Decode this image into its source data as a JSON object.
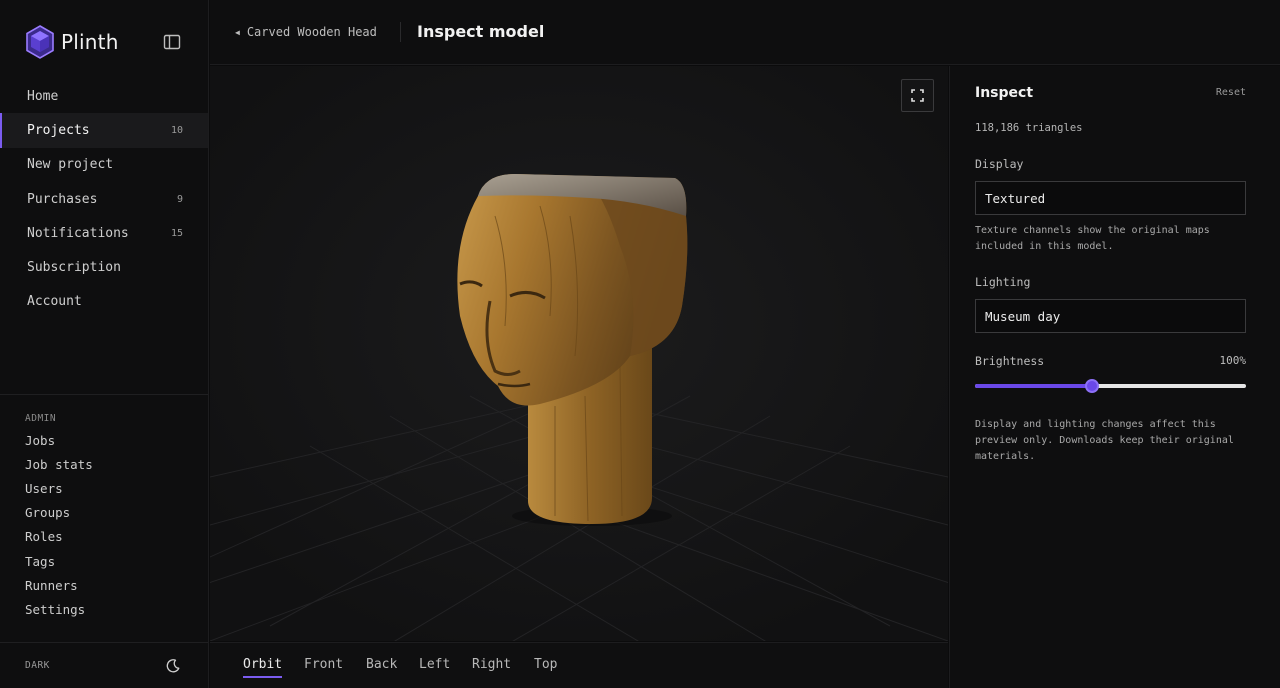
{
  "brand": {
    "name": "Plinth",
    "accent": "#7b5cf0"
  },
  "nav": [
    {
      "label": "Home",
      "count": ""
    },
    {
      "label": "Projects",
      "count": "10",
      "active": true
    },
    {
      "label": "New project",
      "count": ""
    },
    {
      "label": "Purchases",
      "count": "9"
    },
    {
      "label": "Notifications",
      "count": "15"
    },
    {
      "label": "Subscription",
      "count": ""
    },
    {
      "label": "Account",
      "count": ""
    }
  ],
  "admin": {
    "heading": "ADMIN",
    "items": [
      "Jobs",
      "Job stats",
      "Users",
      "Groups",
      "Roles",
      "Tags",
      "Runners",
      "Settings"
    ]
  },
  "theme": {
    "label": "DARK",
    "icon": "moon-icon"
  },
  "header": {
    "back_label": "Carved Wooden Head",
    "title": "Inspect model"
  },
  "viewer": {
    "tabs": [
      "Orbit",
      "Front",
      "Back",
      "Left",
      "Right",
      "Top"
    ],
    "active_tab": "Orbit",
    "fullscreen_icon": "fullscreen-icon"
  },
  "inspect": {
    "title": "Inspect",
    "reset_label": "Reset",
    "triangles": "118,186 triangles",
    "display_label": "Display",
    "display_value": "Textured",
    "display_help": "Texture channels show the original maps included in this model.",
    "lighting_label": "Lighting",
    "lighting_value": "Museum day",
    "brightness_label": "Brightness",
    "brightness_value": "100%",
    "brightness_fraction": 0.43,
    "footnote": "Display and lighting changes affect this preview only. Downloads keep their original materials."
  }
}
